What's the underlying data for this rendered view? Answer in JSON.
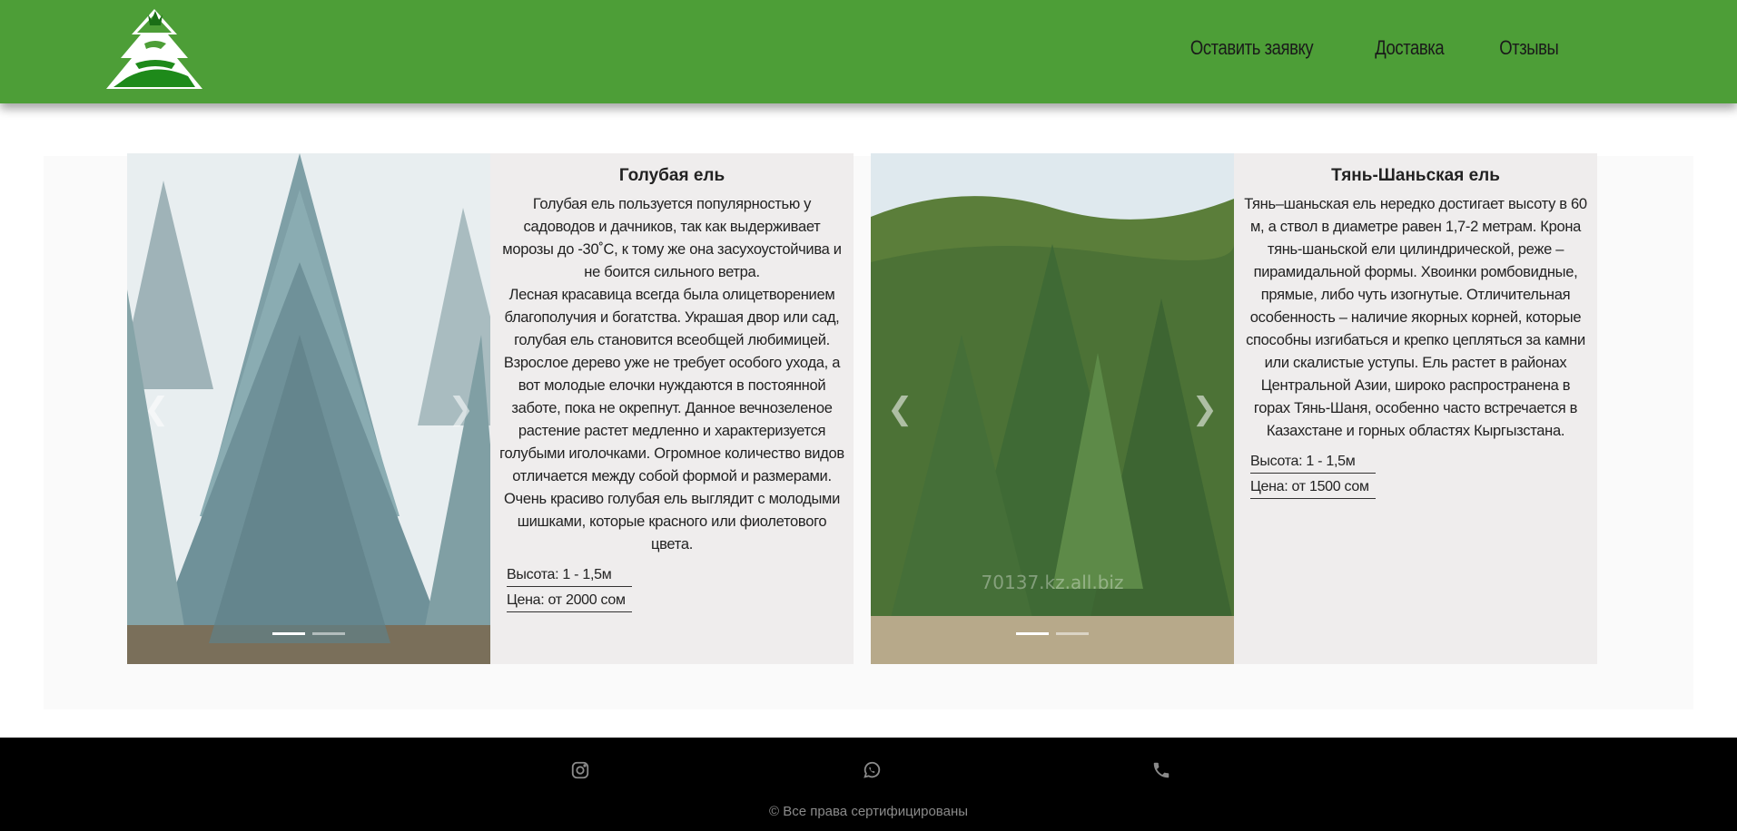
{
  "nav": {
    "items": [
      {
        "label": "Оставить заявку"
      },
      {
        "label": "Доставка"
      },
      {
        "label": "Отзывы"
      }
    ]
  },
  "products": [
    {
      "title": "Голубая ель",
      "description": "Голубая ель пользуется популярностью у садоводов и дачников, так как выдерживает морозы до -30˚С, к тому же она засухоустойчива и не боится сильного ветра.\nЛесная красавица всегда была олицетворением благополучия и богатства. Украшая двор или сад, голубая ель становится всеобщей любимицей. Взрослое дерево уже не требует особого ухода, а вот молодые елочки нуждаются в постоянной заботе, пока не окрепнут. Данное вечнозеленое растение растет медленно и характеризуется голубыми иголочками. Огромное количество видов отличается между собой формой и размерами. Очень красиво голубая ель выглядит с молодыми шишками, которые красного или фиолетового цвета.",
      "height": "Высота: 1 - 1,5м",
      "price": "Цена: от 2000 сом",
      "slides": 2,
      "active_slide": 1
    },
    {
      "title": "Тянь-Шаньская ель",
      "description": "Тянь–шаньская ель нередко достигает высоту в 60 м, а ствол в диаметре равен 1,7-2 метрам. Крона тянь-шаньской ели цилиндрической, реже – пирамидальной формы. Хвоинки ромбовидные, прямые, либо чуть изогнутые. Отличительная особенность – наличие якорных корней, которые способны изгибаться и крепко цепляться за камни или скалистые уступы. Ель растет в районах Центральной Азии, широко распространена в горах Тянь-Шаня, особенно часто встречается в Казахстане и горных областях Кыргызстана.",
      "height": "Высота: 1 - 1,5м",
      "price": "Цена: от 1500 сом",
      "watermark": "70137.kz.all.biz",
      "slides": 2,
      "active_slide": 1
    }
  ],
  "footer": {
    "icons": [
      "instagram-icon",
      "whatsapp-icon",
      "phone-icon"
    ],
    "copyright": "© Все права сертифицированы"
  },
  "colors": {
    "header": "#4d9e37",
    "info_bg": "#efeded",
    "footer": "#000000"
  }
}
